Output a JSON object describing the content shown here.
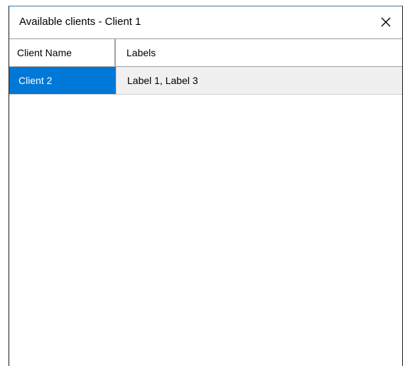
{
  "window": {
    "title": "Available clients - Client 1",
    "close_icon": "close-icon"
  },
  "table": {
    "columns": [
      "Client Name",
      "Labels"
    ],
    "rows": [
      {
        "client_name": "Client 2",
        "labels": "Label 1, Label 3",
        "selected": true
      }
    ]
  },
  "colors": {
    "selection": "#0078d7",
    "row_background": "#f0f0f0",
    "title_border": "#3c7fb1"
  }
}
